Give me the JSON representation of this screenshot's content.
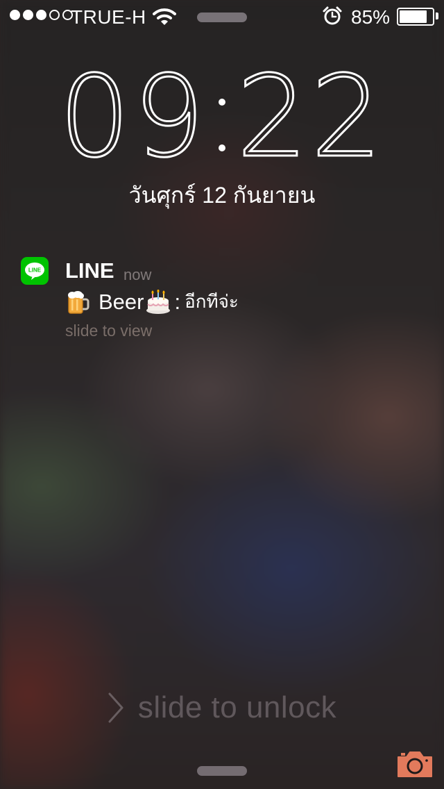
{
  "status_bar": {
    "signal_strength": 3,
    "signal_max": 5,
    "carrier": "TRUE-H",
    "wifi_icon": "wifi-icon",
    "alarm_icon": "alarm-clock-icon",
    "battery_percent_text": "85%",
    "battery_level": 0.85
  },
  "lock_screen": {
    "time_hours": "09",
    "time_minutes": "22",
    "date": "วันศุกร์ 12 กันยายน"
  },
  "notification": {
    "app_icon": "line-app-icon",
    "app_icon_text": "LINE",
    "app_name": "LINE",
    "time": "now",
    "sender_emoji_left": "beer-mug-emoji",
    "sender_name": "Beer",
    "sender_emoji_right": "birthday-cake-emoji",
    "separator": ":",
    "message": "อีกทีจ่ะ",
    "hint": "slide to view"
  },
  "unlock": {
    "chevron_icon": "chevron-right-icon",
    "label": "slide to unlock"
  },
  "camera": {
    "icon": "camera-icon"
  },
  "colors": {
    "line_green": "#00c300",
    "camera_orange": "#e27a5c"
  }
}
